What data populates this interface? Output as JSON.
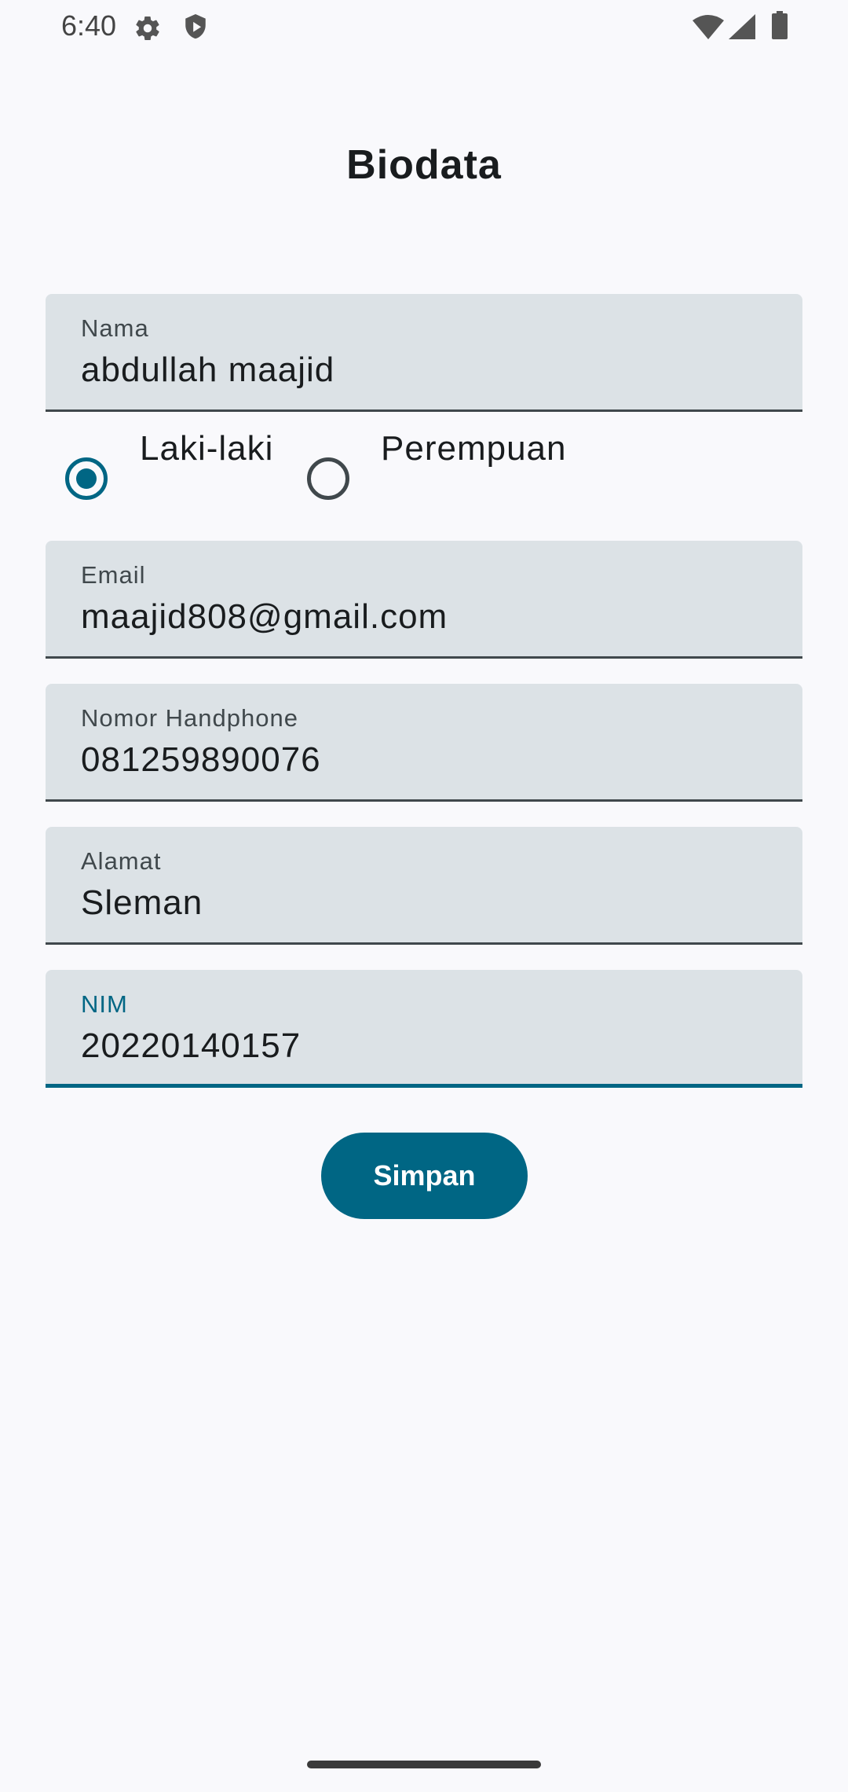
{
  "status_bar": {
    "time": "6:40",
    "icons": [
      "gear-icon",
      "shield-icon",
      "wifi-icon",
      "cell-signal-icon",
      "battery-icon"
    ]
  },
  "page": {
    "title": "Biodata"
  },
  "form": {
    "nama": {
      "label": "Nama",
      "value": "abdullah maajid"
    },
    "gender": {
      "options": [
        "Laki-laki",
        "Perempuan"
      ],
      "selected": "Laki-laki"
    },
    "email": {
      "label": "Email",
      "value": "maajid808@gmail.com"
    },
    "phone": {
      "label": "Nomor Handphone",
      "value": "081259890076"
    },
    "alamat": {
      "label": "Alamat",
      "value": "Sleman"
    },
    "nim": {
      "label": "NIM",
      "value": "20220140157"
    }
  },
  "actions": {
    "save_label": "Simpan"
  },
  "colors": {
    "primary": "#006684",
    "field_bg": "#DCE2E6",
    "background": "#F9F9FC"
  }
}
